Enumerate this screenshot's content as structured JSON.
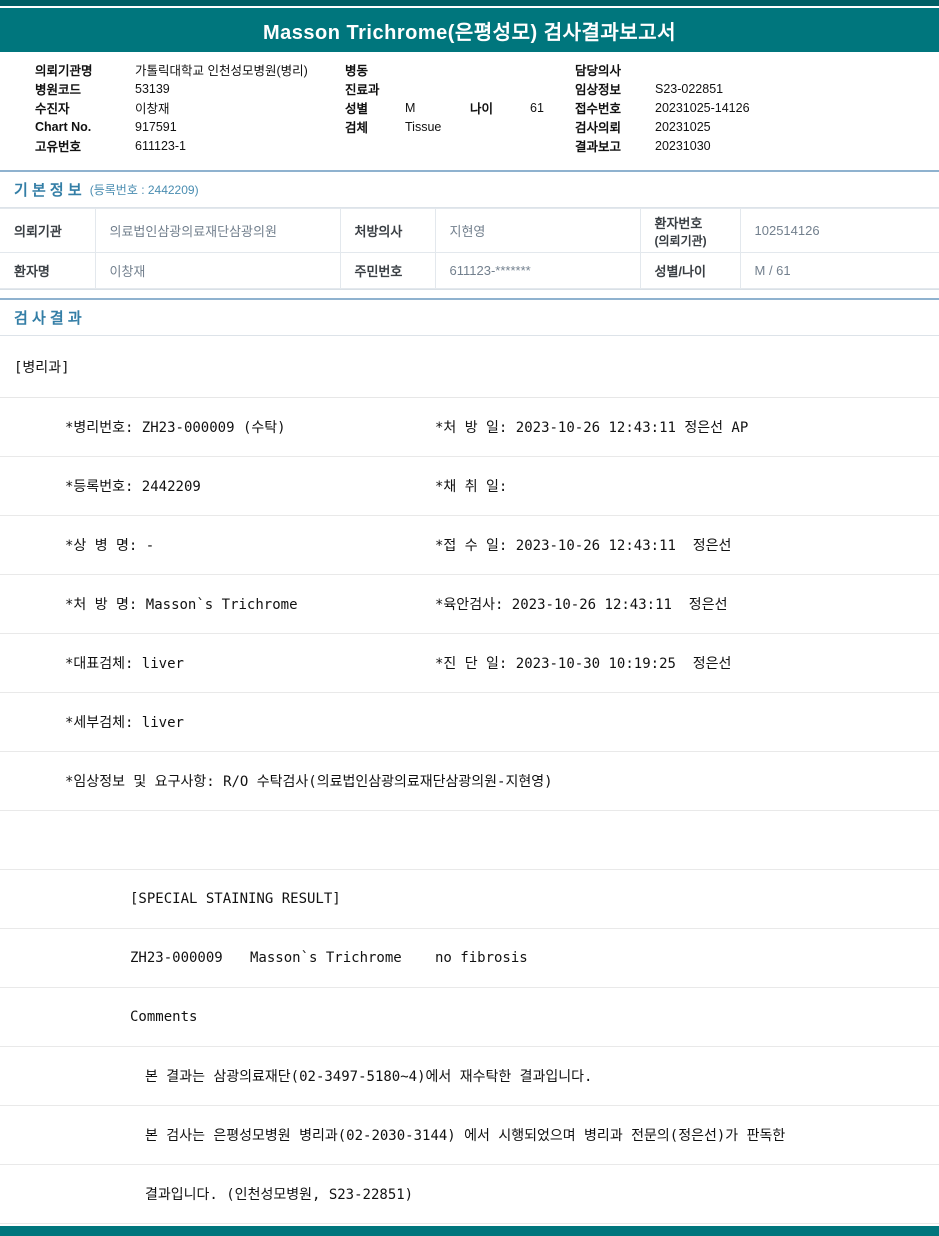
{
  "report": {
    "title": "Masson Trichrome(은평성모) 검사결과보고서"
  },
  "id_header": {
    "left": [
      {
        "label": "의뢰기관명",
        "value": "가톨릭대학교 인천성모병원(병리)"
      },
      {
        "label": "병원코드",
        "value": "53139"
      },
      {
        "label": "수진자",
        "value": "이창재"
      },
      {
        "label": "Chart No.",
        "value": "917591"
      },
      {
        "label": "고유번호",
        "value": "611123-1"
      }
    ],
    "mid": {
      "ward_label": "병동",
      "ward_value": "",
      "dept_label": "진료과",
      "dept_value": "",
      "sex_label": "성별",
      "sex_value": "M",
      "age_label": "나이",
      "age_value": "61",
      "specimen_label": "검체",
      "specimen_value": "Tissue"
    },
    "right": [
      {
        "label": "담당의사",
        "value": ""
      },
      {
        "label": "임상정보",
        "value": "S23-022851"
      },
      {
        "label": "접수번호",
        "value": "20231025-14126"
      },
      {
        "label": "검사의뢰",
        "value": "20231025"
      },
      {
        "label": "결과보고",
        "value": "20231030"
      }
    ]
  },
  "basic_info": {
    "title": "기 본 정 보",
    "subtitle": "(등록번호 : 2442209)",
    "rows": [
      {
        "c1": "의뢰기관",
        "c2": "의료법인삼광의료재단삼광의원",
        "c3": "처방의사",
        "c4": "지현영",
        "c5a": "환자번호",
        "c5b": "(의뢰기관)",
        "c6": "102514126"
      },
      {
        "c1": "환자명",
        "c2": "이창재",
        "c3": "주민번호",
        "c4": "611123-*******",
        "c5a": "성별/나이",
        "c5b": "",
        "c6": "M / 61"
      }
    ]
  },
  "results": {
    "title": "검 사 결 과",
    "department": "[병리과]",
    "rows": [
      {
        "left": "*병리번호: ZH23-000009 (수탁)",
        "right": "*처 방 일: 2023-10-26 12:43:11 정은선 AP"
      },
      {
        "left": "*등록번호: 2442209",
        "right": "*채 취 일:"
      },
      {
        "left": "*상 병 명: -",
        "right": "*접 수 일: 2023-10-26 12:43:11  정은선"
      },
      {
        "left": "*처 방 명: Masson`s Trichrome",
        "right": "*육안검사: 2023-10-26 12:43:11  정은선"
      },
      {
        "left": "*대표검체: liver",
        "right": "*진 단 일: 2023-10-30 10:19:25  정은선"
      },
      {
        "left": "*세부검체: liver"
      },
      {
        "left": "*임상정보 및 요구사항: R/O 수탁검사(의료법인삼광의료재단삼광의원-지현영)"
      },
      {},
      {
        "left": "[SPECIAL STAINING RESULT]"
      },
      {
        "a": "ZH23-000009",
        "b": "Masson`s Trichrome",
        "c": "no fibrosis"
      },
      {
        "left": "Comments"
      },
      {
        "left": "본 결과는 삼광의료재단(02-3497-5180~4)에서 재수탁한 결과입니다."
      },
      {
        "left": "본 검사는 은평성모병원 병리과(02-2030-3144) 에서 시행되었으며 병리과 전문의(정은선)가 판독한"
      },
      {
        "left": "결과입니다. (인천성모병원, S23-22851)"
      }
    ]
  }
}
